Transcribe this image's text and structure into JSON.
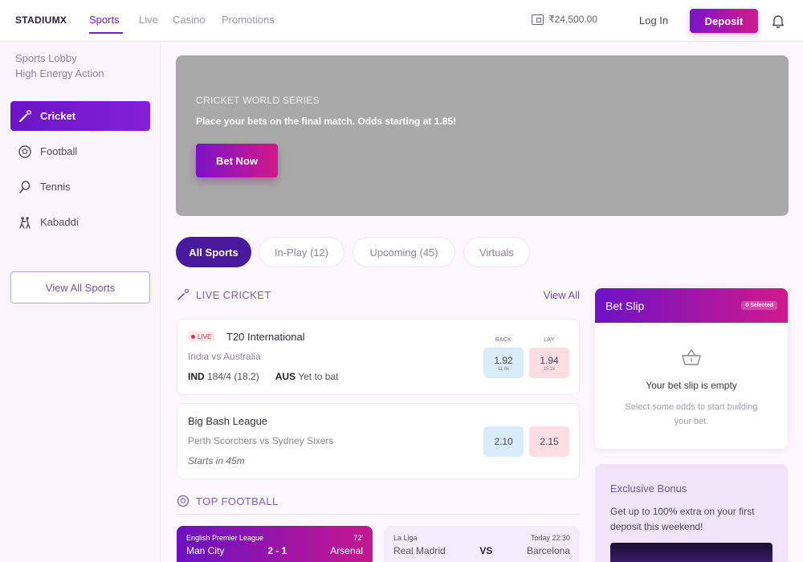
{
  "header": {
    "logo": "STADIUMX",
    "nav": [
      "Sports",
      "Live",
      "Casino",
      "Promotions"
    ],
    "active_nav": "Sports",
    "balance": "₹24,500.00",
    "login_label": "Log In",
    "deposit_label": "Deposit"
  },
  "sidebar": {
    "title": "Sports Lobby",
    "subtitle": "High Energy Action",
    "items": [
      {
        "label": "Cricket",
        "icon": "cricket-icon",
        "active": true
      },
      {
        "label": "Football",
        "icon": "football-icon"
      },
      {
        "label": "Tennis",
        "icon": "tennis-icon"
      },
      {
        "label": "Kabaddi",
        "icon": "kabaddi-icon"
      }
    ],
    "view_all_label": "View All Sports"
  },
  "banner": {
    "kicker": "CRICKET WORLD SERIES",
    "text": "Place your bets on the final match. Odds starting at 1.85!",
    "cta": "Bet Now",
    "bg_color": "#a9a9a9"
  },
  "tabs": [
    "All Sports",
    "In-Play (12)",
    "Upcoming (45)",
    "Virtuals"
  ],
  "live_cricket": {
    "title": "LIVE CRICKET",
    "view_all": "View All",
    "matches": [
      {
        "badge": "LIVE",
        "league": "T20 International",
        "teams": "India vs Australia",
        "score_team1": "IND",
        "score_team1_value": "184/4 (18.2)",
        "score_team2": "AUS",
        "score_team2_value": "Yet to bat",
        "back_label": "BACK",
        "lay_label": "LAY",
        "back_odd": "1.92",
        "back_sub": "11.6k",
        "lay_odd": "1.94",
        "lay_sub": "15.2k"
      },
      {
        "league": "Big Bash League",
        "teams": "Perth Scorchers vs Sydney Sixers",
        "status": "Starts in 45m",
        "back_odd": "2.10",
        "lay_odd": "2.15"
      }
    ]
  },
  "top_football": {
    "title": "TOP FOOTBALL",
    "cards": [
      {
        "league": "English Premier League",
        "time": "72'",
        "home": "Man City",
        "score": "2 - 1",
        "away": "Arsenal"
      },
      {
        "league": "La Liga",
        "time": "Today 22:30",
        "home": "Real Madrid",
        "score": "VS",
        "away": "Barcelona"
      }
    ]
  },
  "betslip": {
    "title": "Bet Slip",
    "badge": "0 Selected",
    "empty_title": "Your bet slip is empty",
    "empty_hint": "Select some odds to start building your bet."
  },
  "bonus": {
    "title": "Exclusive Bonus",
    "text": "Get up to 100% extra on your first deposit this weekend!"
  },
  "colors": {
    "accent": "#6b1fc4",
    "gradient_start": "#7d12c8",
    "gradient_end": "#d11b8c"
  }
}
